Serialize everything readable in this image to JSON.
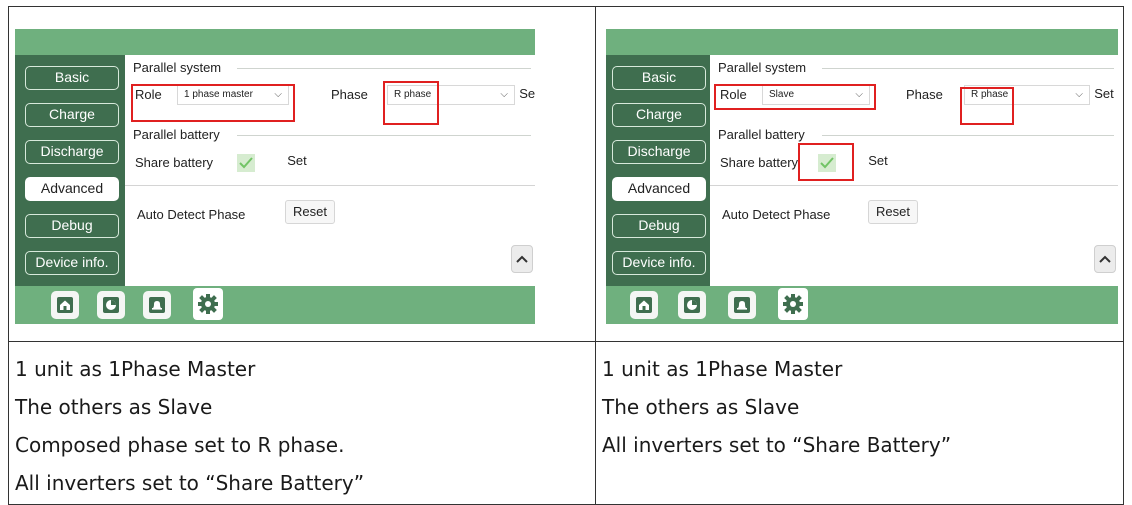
{
  "colors": {
    "green_bar": "#6fb07e",
    "sidebar": "#3f6e4f",
    "highlight": "#e02020"
  },
  "panels": [
    {
      "sidebar": [
        "Basic",
        "Charge",
        "Discharge",
        "Advanced",
        "Debug",
        "Device info."
      ],
      "active_item": "Advanced",
      "parallel_system": "Parallel system",
      "role_label": "Role",
      "role_value": "1 phase master",
      "phase_label": "Phase",
      "phase_value": "R phase",
      "set_label": "Set",
      "parallel_battery": "Parallel battery",
      "share_battery_label": "Share battery",
      "share_battery_checked": true,
      "battery_set_label": "Set",
      "auto_detect_label": "Auto Detect Phase",
      "reset_label": "Reset",
      "nav_icons": [
        "home-icon",
        "pie-chart-icon",
        "bell-icon",
        "gear-icon"
      ]
    },
    {
      "sidebar": [
        "Basic",
        "Charge",
        "Discharge",
        "Advanced",
        "Debug",
        "Device info."
      ],
      "active_item": "Advanced",
      "parallel_system": "Parallel system",
      "role_label": "Role",
      "role_value": "Slave",
      "phase_label": "Phase",
      "phase_value": "R phase",
      "set_label": "Set",
      "parallel_battery": "Parallel battery",
      "share_battery_label": "Share battery",
      "share_battery_checked": true,
      "battery_set_label": "Set",
      "auto_detect_label": "Auto Detect Phase",
      "reset_label": "Reset",
      "nav_icons": [
        "home-icon",
        "pie-chart-icon",
        "bell-icon",
        "gear-icon"
      ]
    }
  ],
  "captions": [
    [
      "1 unit as 1Phase Master",
      "The others as Slave",
      "Composed phase set to R phase.",
      "All inverters set to “Share Battery”"
    ],
    [
      "1 unit as 1Phase Master",
      "The others as Slave",
      "All inverters set to “Share Battery”"
    ]
  ]
}
